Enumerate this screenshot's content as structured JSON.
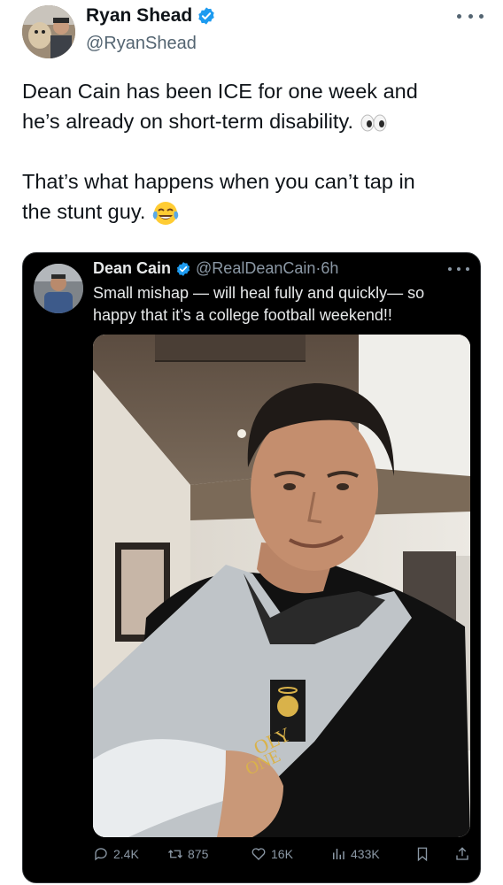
{
  "tweet": {
    "author_name": "Ryan Shead",
    "author_handle": "@RyanShead",
    "line1": "Dean Cain has been ICE for one week and",
    "line2": "he’s already on short-term disability.",
    "line3": "That’s what happens when you can’t tap in",
    "line4": "the stunt guy.",
    "emoji_eyes": "eyes-emoji",
    "emoji_laugh": "face-with-tears-of-joy-emoji"
  },
  "quote": {
    "author_name": "Dean Cain",
    "author_handle": "@RealDeanCain",
    "separator": "·",
    "time": "6h",
    "line1": "Small mishap — will heal fully and quickly— so",
    "line2": "happy that it’s a college football weekend!!",
    "shirt_text1": "OLY",
    "shirt_text2": "ONE",
    "actions": {
      "replies": "2.4K",
      "reposts": "875",
      "likes": "16K",
      "views": "433K"
    }
  },
  "colors": {
    "verified_blue": "#1d9bf0",
    "dark_card": "#000000",
    "muted_text": "#8b98a5"
  }
}
